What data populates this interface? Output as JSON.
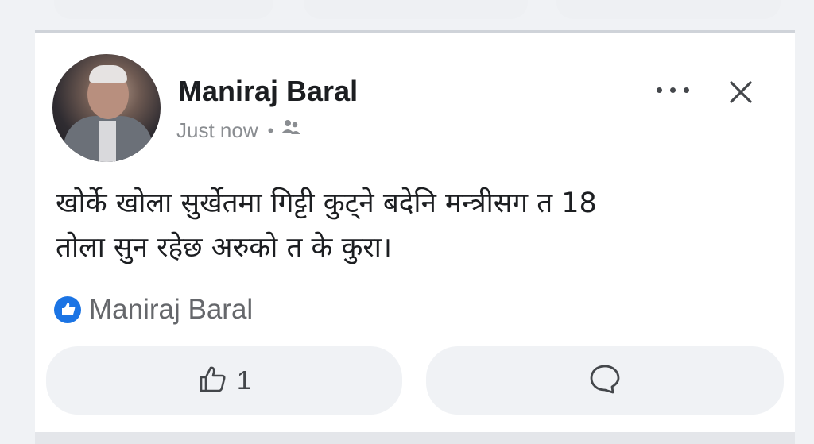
{
  "post": {
    "author": "Maniraj Baral",
    "timestamp": "Just now",
    "separator": "•",
    "privacy_icon": "friends-icon",
    "text_line1": "खोर्के खोला सुर्खेतमा गिट्टी कुट्ने बदेनि मन्त्रीसग त 18",
    "text_line2": "तोला सुन रहेछ अरुको त के कुरा।",
    "reaction_icon": "like-badge-icon",
    "reactor_name": "Maniraj Baral",
    "like_count": "1"
  },
  "colors": {
    "accent": "#1b74e4",
    "text_primary": "#1c1e21",
    "text_secondary": "#65676b",
    "button_bg": "#f0f2f5"
  }
}
